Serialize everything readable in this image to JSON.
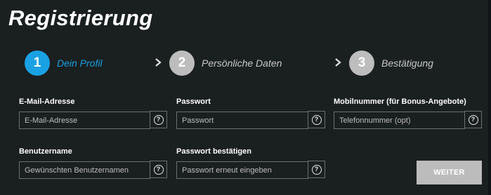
{
  "page": {
    "title": "Registrierung"
  },
  "stepper": {
    "steps": [
      {
        "number": "1",
        "label": "Dein Profil",
        "active": true
      },
      {
        "number": "2",
        "label": "Persönliche Daten",
        "active": false
      },
      {
        "number": "3",
        "label": "Bestätigung",
        "active": false
      }
    ],
    "separator_icon": "chevron-right-icon"
  },
  "form": {
    "email": {
      "label": "E-Mail-Adresse",
      "placeholder": "E-Mail-Adresse",
      "value": ""
    },
    "password": {
      "label": "Passwort",
      "placeholder": "Passwort",
      "value": ""
    },
    "mobile": {
      "label": "Mobilnummer (für Bonus-Angebote)",
      "placeholder": "Telefonnummer (opt)",
      "value": ""
    },
    "username": {
      "label": "Benutzername",
      "placeholder": "Gewünschten Benutzernamen",
      "value": ""
    },
    "password_confirm": {
      "label": "Passwort bestätigen",
      "placeholder": "Passwort erneut eingeben",
      "value": ""
    },
    "help_icon_text": "?",
    "submit_label": "WEITER"
  },
  "colors": {
    "background": "#1a1f20",
    "accent": "#1aa1e3",
    "inactive_step": "#bdbdbd",
    "field_border": "#6b6f70",
    "button": "#bcbcbc"
  }
}
